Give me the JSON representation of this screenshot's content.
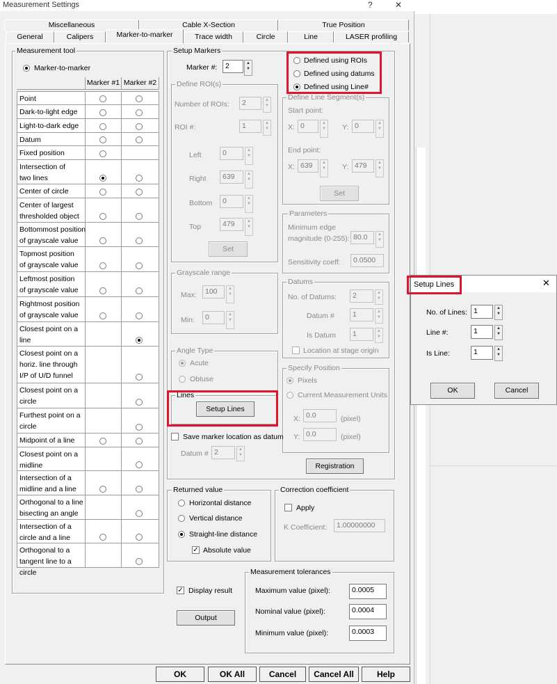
{
  "window": {
    "title": "Measurement Settings",
    "help_glyph": "?",
    "close_glyph": "✕"
  },
  "tabs_top": [
    "Miscellaneous",
    "Cable X-Section",
    "True Position"
  ],
  "tabs_bottom": [
    "General",
    "Calipers",
    "Marker-to-marker",
    "Trace width",
    "Circle",
    "Line",
    "LASER profiling"
  ],
  "measurement_tool": {
    "title": "Measurement tool",
    "option": "Marker-to-marker",
    "col1": "Marker #1",
    "col2": "Marker #2",
    "rows": [
      {
        "l1": "Point",
        "l2": ""
      },
      {
        "l1": "Dark-to-light edge",
        "l2": ""
      },
      {
        "l1": "Light-to-dark edge",
        "l2": ""
      },
      {
        "l1": "Datum",
        "l2": ""
      },
      {
        "l1": "Fixed position",
        "l2": ""
      },
      {
        "l1": "Intersection of",
        "l2": "two lines"
      },
      {
        "l1": "Center of circle",
        "l2": ""
      },
      {
        "l1": "Center of largest",
        "l2": "thresholded object"
      },
      {
        "l1": "Bottommost position",
        "l2": "of grayscale value"
      },
      {
        "l1": "Topmost position",
        "l2": "of grayscale value"
      },
      {
        "l1": "Leftmost position",
        "l2": "of grayscale value"
      },
      {
        "l1": "Rightmost position",
        "l2": "of grayscale value"
      },
      {
        "l1": "Closest point on a",
        "l2": "line"
      },
      {
        "l1": "Closest point on a",
        "l2": "horiz. line through",
        "l3": "I/P of U/D funnel"
      },
      {
        "l1": "Closest point on a",
        "l2": "circle"
      },
      {
        "l1": "Furthest point on a",
        "l2": "circle"
      },
      {
        "l1": "Midpoint of a line",
        "l2": ""
      },
      {
        "l1": "Closest point on a",
        "l2": "midline"
      },
      {
        "l1": "Intersection of a",
        "l2": "midline and a line"
      },
      {
        "l1": "Orthogonal to a line",
        "l2": "bisecting an angle"
      },
      {
        "l1": "Intersection of a",
        "l2": "circle and a line"
      },
      {
        "l1": "Orthogonal to a",
        "l2": "tangent line to a",
        "l3": "circle"
      }
    ]
  },
  "setup_markers": {
    "title": "Setup Markers",
    "marker_label": "Marker #:",
    "marker_value": "2",
    "define_roi": {
      "title": "Define ROI(s)",
      "num_rois_label": "Number of ROIs:",
      "num_rois": "2",
      "roi_label": "ROI #:",
      "roi": "1",
      "left_label": "Left",
      "left": "0",
      "right_label": "Right",
      "right": "639",
      "bottom_label": "Bottom",
      "bottom": "0",
      "top_label": "Top",
      "top": "479",
      "set": "Set"
    },
    "define_mode": {
      "rois": "Defined using ROIs",
      "datums": "Defined using datums",
      "line": "Defined using Line#"
    },
    "line_segments": {
      "title": "Define Line Segment(s)",
      "start": "Start point:",
      "end": "End point:",
      "x_label": "X:",
      "y_label": "Y:",
      "start_x": "0",
      "start_y": "0",
      "end_x": "639",
      "end_y": "479",
      "set": "Set"
    },
    "parameters": {
      "title": "Parameters",
      "min_edge_l1": "Minimum edge",
      "min_edge_l2": "magnitude (0-255):",
      "min_edge": "80.0",
      "sensitivity_label": "Sensitivity coeff:",
      "sensitivity": "0.0500"
    },
    "grayscale": {
      "title": "Grayscale range",
      "max_label": "Max:",
      "max": "100",
      "min_label": "Min:",
      "min": "0"
    },
    "datums": {
      "title": "Datums",
      "num_label": "No. of Datums:",
      "num": "2",
      "datum_label": "Datum #",
      "datum": "1",
      "is_label": "Is Datum",
      "is": "1",
      "location": "Location at stage origin"
    },
    "angle_type": {
      "title": "Angle Type",
      "acute": "Acute",
      "obtuse": "Obtuse"
    },
    "specify_position": {
      "title": "Specify Position",
      "pixels": "Pixels",
      "units": "Current Measurement Units",
      "x_label": "X:",
      "x": "0.0",
      "x_unit": "(pixel)",
      "y_label": "Y:",
      "y": "0.0",
      "y_unit": "(pixel)"
    },
    "lines": {
      "title": "Lines",
      "button": "Setup Lines"
    },
    "save_marker": "Save marker location as datum",
    "datum_hash_label": "Datum #",
    "datum_hash": "2",
    "registration": "Registration"
  },
  "returned_value": {
    "title": "Returned value",
    "horizontal": "Horizontal distance",
    "vertical": "Vertical distance",
    "straight": "Straight-line distance",
    "absolute": "Absolute value"
  },
  "correction": {
    "title": "Correction coefficient",
    "apply": "Apply",
    "k_label": "K Coefficient:",
    "k": "1.00000000"
  },
  "display_result": "Display result",
  "output": "Output",
  "tolerances": {
    "title": "Measurement tolerances",
    "max_label": "Maximum value (pixel):",
    "max": "0.0005",
    "nom_label": "Nominal value (pixel):",
    "nom": "0.0004",
    "min_label": "Minimum value (pixel):",
    "min": "0.0003"
  },
  "bottom_buttons": [
    "OK",
    "OK All",
    "Cancel",
    "Cancel All",
    "Help"
  ],
  "setup_lines_dialog": {
    "title": "Setup Lines",
    "close_glyph": "✕",
    "num_label": "No. of Lines:",
    "num": "1",
    "line_label": "Line #:",
    "line": "1",
    "is_label": "Is Line:",
    "is": "1",
    "ok": "OK",
    "cancel": "Cancel"
  },
  "colors": {
    "highlight": "#e0142c",
    "face": "#f0f0f0"
  }
}
